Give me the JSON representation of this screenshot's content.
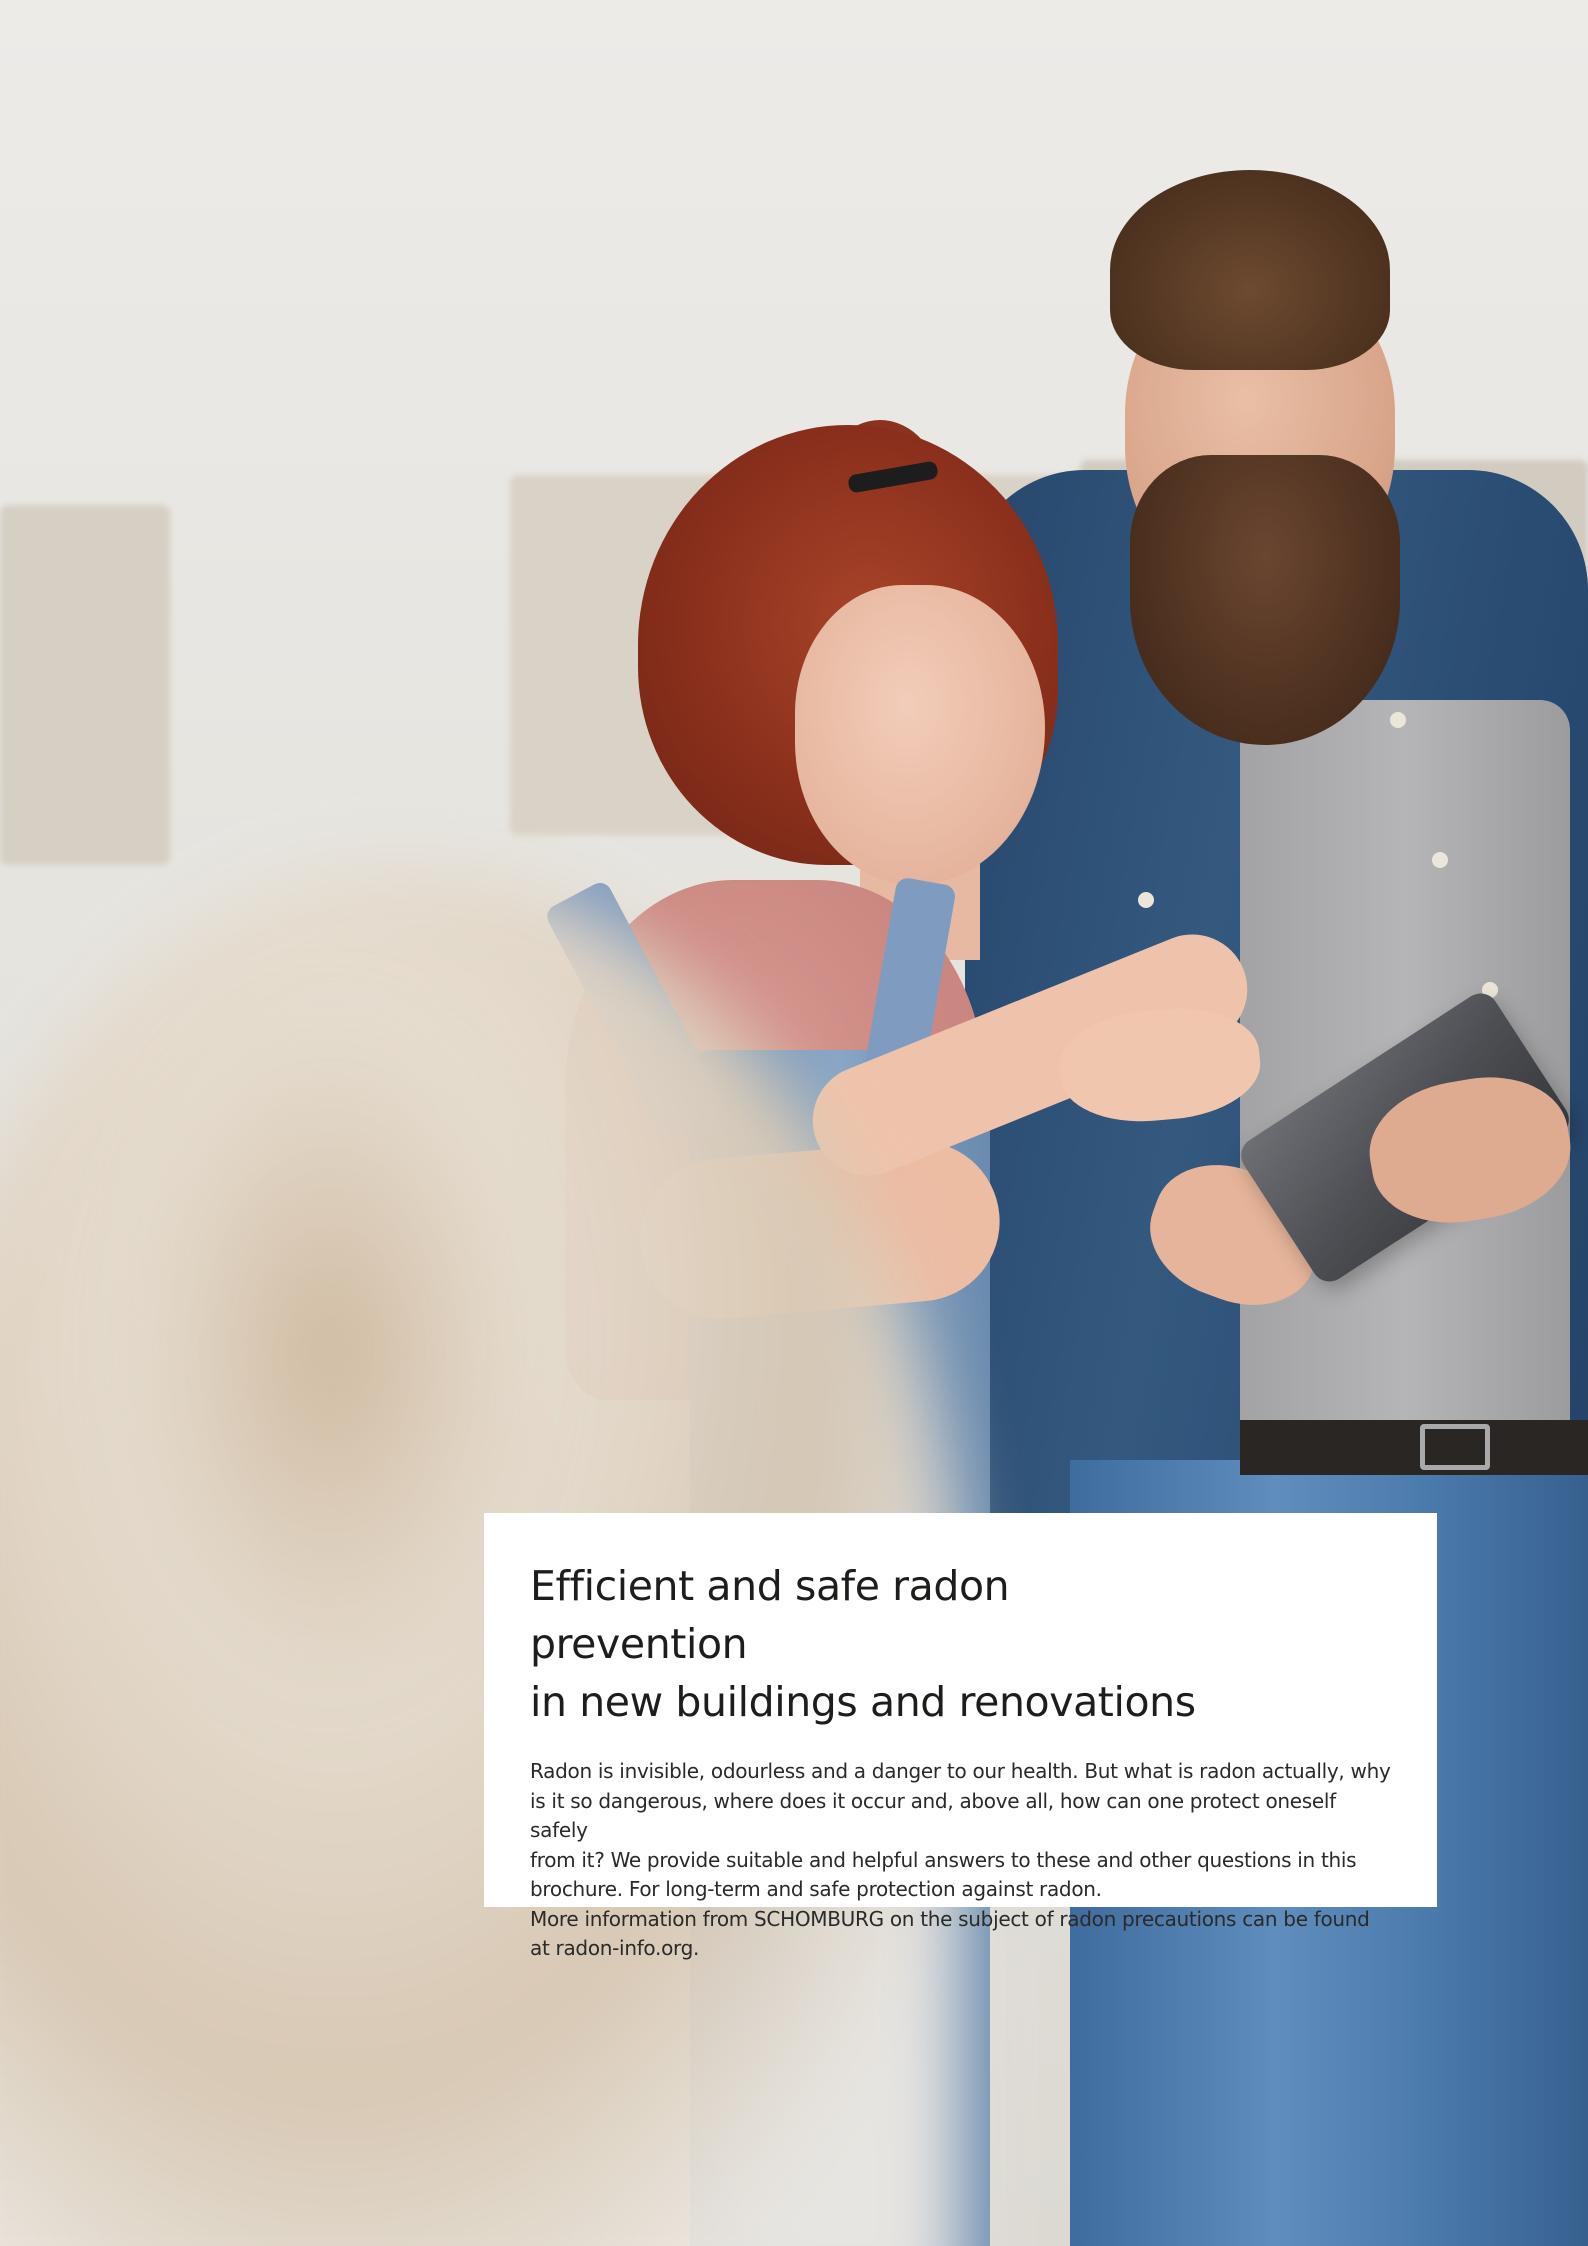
{
  "photo": {
    "description_icon": "photo-couple-tablet"
  },
  "card": {
    "title_line1": "Efficient and safe radon prevention",
    "title_line2": "in new buildings and renovations",
    "body_line1": "Radon is invisible, odourless and a danger to our health. But what is radon actually, why",
    "body_line2": "is it so dangerous, where does it occur and, above all, how can one protect oneself safely",
    "body_line3": "from it? We provide suitable and helpful answers to these and other questions in this",
    "body_line4": "brochure. For long-term and safe protection against radon.",
    "body_line5": "More information from SCHOMBURG on the subject of radon precautions can be found",
    "body_line6": "at radon-info.org."
  },
  "colors": {
    "card_background": "#ffffff",
    "text": "#1d1d1b",
    "wall": "#e9e7e3"
  }
}
